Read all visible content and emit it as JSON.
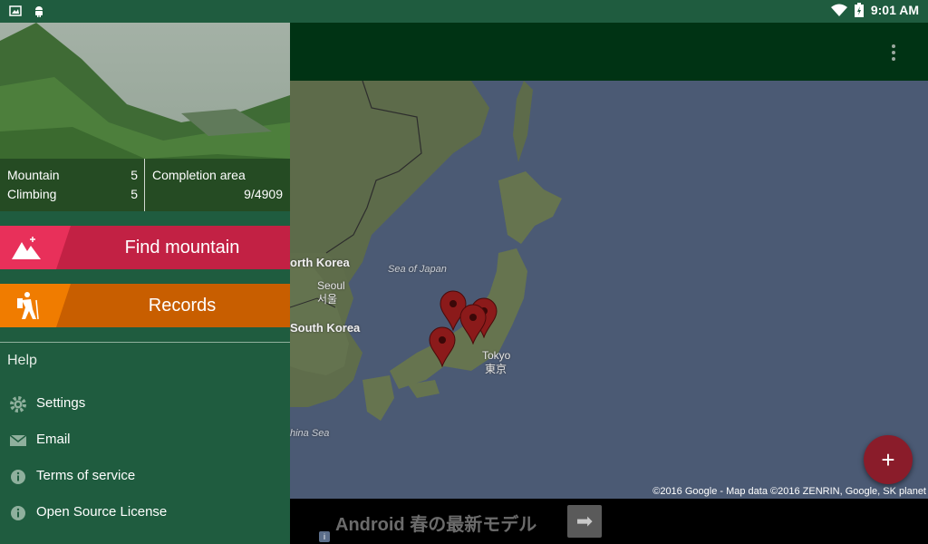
{
  "status_bar": {
    "time": "9:01 AM"
  },
  "drawer": {
    "stats": {
      "mountain_label": "Mountain",
      "mountain_value": "5",
      "climbing_label": "Climbing",
      "climbing_value": "5",
      "completion_label": "Completion area",
      "completion_value": "9/4909"
    },
    "find_button": "Find mountain",
    "records_button": "Records",
    "help_label": "Help",
    "menu": [
      {
        "label": "Settings",
        "icon": "gear-icon"
      },
      {
        "label": "Email",
        "icon": "envelope-icon"
      },
      {
        "label": "Terms of service",
        "icon": "info-icon"
      },
      {
        "label": "Open Source License",
        "icon": "info-icon"
      }
    ]
  },
  "map": {
    "labels": {
      "north_korea": "orth Korea",
      "seoul": "Seoul",
      "seoul_ko": "서울",
      "south_korea": "South Korea",
      "sea_of_japan": "Sea of Japan",
      "tokyo": "Tokyo",
      "tokyo_jp": "東京",
      "china_sea": "hina Sea"
    },
    "copyright": "©2016 Google - Map data ©2016 ZENRIN, Google, SK planet",
    "colors": {
      "water": "#4b5a74",
      "land": "#5d6b4a",
      "marker": "#8b1a1a"
    }
  },
  "fab": {
    "label": "+"
  },
  "ad": {
    "text": "Android 春の最新モデル",
    "arrow": "➡",
    "info": "i"
  }
}
